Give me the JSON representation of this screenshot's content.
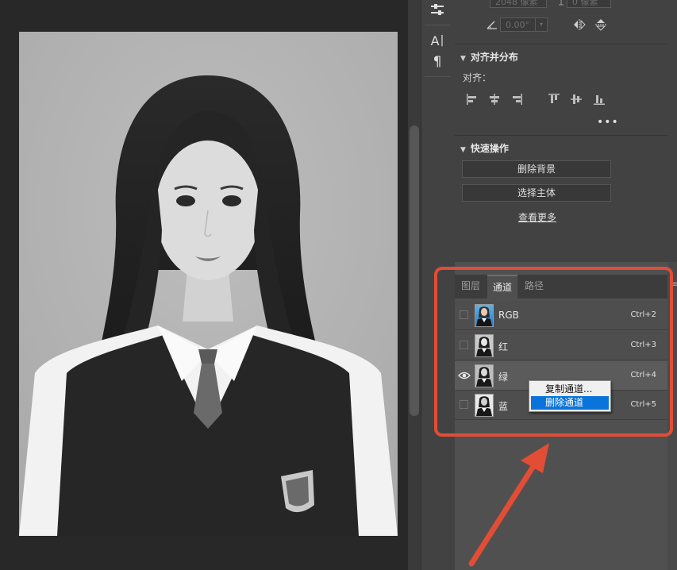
{
  "toolbar": {
    "tools": [
      {
        "name": "adjust-icon",
        "glyph": "≡"
      },
      {
        "name": "character-icon",
        "glyph": "A|"
      },
      {
        "name": "paragraph-icon",
        "glyph": "¶"
      }
    ]
  },
  "properties": {
    "transform": {
      "width_value": "2048 像素",
      "height_value": "0 像素",
      "angle_value": "0.00°"
    },
    "align_section": {
      "title": "对齐并分布",
      "align_label": "对齐："
    },
    "quick_actions": {
      "title": "快速操作",
      "remove_background": "删除背景",
      "select_subject": "选择主体",
      "see_more": "查看更多"
    }
  },
  "panel": {
    "tabs": [
      {
        "label": "图层",
        "active": false
      },
      {
        "label": "通道",
        "active": true
      },
      {
        "label": "路径",
        "active": false
      }
    ],
    "channels": [
      {
        "name": "RGB",
        "shortcut": "Ctrl+2",
        "visible": false,
        "selected": false
      },
      {
        "name": "红",
        "shortcut": "Ctrl+3",
        "visible": false,
        "selected": false
      },
      {
        "name": "绿",
        "shortcut": "Ctrl+4",
        "visible": true,
        "selected": true
      },
      {
        "name": "蓝",
        "shortcut": "Ctrl+5",
        "visible": false,
        "selected": false
      }
    ]
  },
  "context_menu": {
    "items": [
      {
        "label": "复制通道...",
        "highlighted": false
      },
      {
        "label": "删除通道",
        "highlighted": true
      }
    ]
  },
  "colors": {
    "annotation": "#e14d35",
    "menu_highlight": "#0a74da",
    "panel_bg": "#424242"
  }
}
